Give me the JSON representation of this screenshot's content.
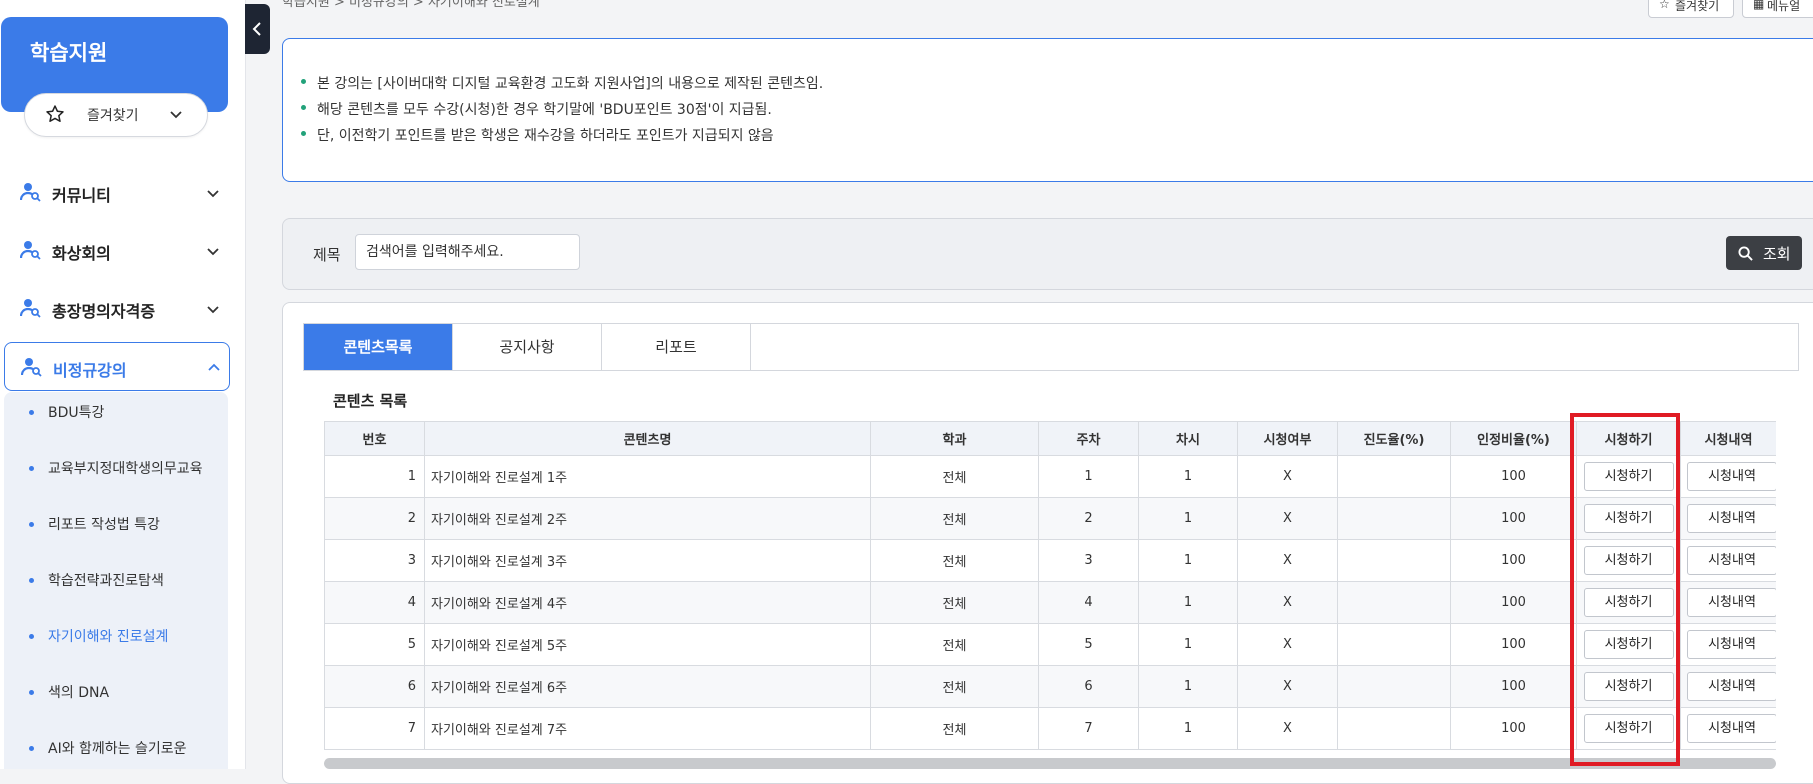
{
  "sidebar": {
    "title": "학습지원",
    "favorites_label": "즐겨찾기",
    "menu": [
      {
        "label": "커뮤니티"
      },
      {
        "label": "화상회의"
      },
      {
        "label": "총장명의자격증"
      },
      {
        "label": "비정규강의"
      }
    ],
    "submenu": [
      {
        "label": "BDU특강"
      },
      {
        "label": "교육부지정대학생의무교육"
      },
      {
        "label": "리포트 작성법 특강"
      },
      {
        "label": "학습전략과진로탐색"
      },
      {
        "label": "자기이해와 진로설계"
      },
      {
        "label": "색의 DNA"
      },
      {
        "label": "AI와 함께하는 슬기로운"
      }
    ]
  },
  "top": {
    "breadcrumb": "학습지원 > 비정규강의 > 자기이해와 진로설계",
    "favorites_button": "즐겨찾기",
    "menu_button": "메뉴얼"
  },
  "notice": {
    "lines": [
      "본 강의는 [사이버대학 디지털 교육환경 고도화 지원사업]의 내용으로 제작된 콘텐츠임.",
      "해당 콘텐츠를 모두 수강(시청)한 경우 학기말에 'BDU포인트 30점'이 지급됨.",
      "단, 이전학기 포인트를 받은 학생은 재수강을 하더라도 포인트가 지급되지 않음"
    ]
  },
  "search": {
    "label": "제목",
    "placeholder": "검색어를 입력해주세요.",
    "button": "조회"
  },
  "tabs": [
    {
      "label": "콘텐츠목록"
    },
    {
      "label": "공지사항"
    },
    {
      "label": "리포트"
    }
  ],
  "table": {
    "title": "콘텐츠 목록",
    "headers": [
      "번호",
      "콘텐츠명",
      "학과",
      "주차",
      "차시",
      "시청여부",
      "진도율(%)",
      "인정비율(%)",
      "시청하기",
      "시청내역"
    ],
    "watch_button": "시청하기",
    "history_button": "시청내역",
    "rows": [
      {
        "no": "1",
        "title": "자기이해와 진로설계 1주",
        "dept": "전체",
        "week": "1",
        "session": "1",
        "watched": "X",
        "progress": "",
        "ratio": "100"
      },
      {
        "no": "2",
        "title": "자기이해와 진로설계 2주",
        "dept": "전체",
        "week": "2",
        "session": "1",
        "watched": "X",
        "progress": "",
        "ratio": "100"
      },
      {
        "no": "3",
        "title": "자기이해와 진로설계 3주",
        "dept": "전체",
        "week": "3",
        "session": "1",
        "watched": "X",
        "progress": "",
        "ratio": "100"
      },
      {
        "no": "4",
        "title": "자기이해와 진로설계 4주",
        "dept": "전체",
        "week": "4",
        "session": "1",
        "watched": "X",
        "progress": "",
        "ratio": "100"
      },
      {
        "no": "5",
        "title": "자기이해와 진로설계 5주",
        "dept": "전체",
        "week": "5",
        "session": "1",
        "watched": "X",
        "progress": "",
        "ratio": "100"
      },
      {
        "no": "6",
        "title": "자기이해와 진로설계 6주",
        "dept": "전체",
        "week": "6",
        "session": "1",
        "watched": "X",
        "progress": "",
        "ratio": "100"
      },
      {
        "no": "7",
        "title": "자기이해와 진로설계 7주",
        "dept": "전체",
        "week": "7",
        "session": "1",
        "watched": "X",
        "progress": "",
        "ratio": "100"
      }
    ]
  },
  "colors": {
    "accent": "#3b7be8",
    "highlight": "#e01b24",
    "dark_button": "#3c3f44",
    "bullet": "#22a27a"
  }
}
